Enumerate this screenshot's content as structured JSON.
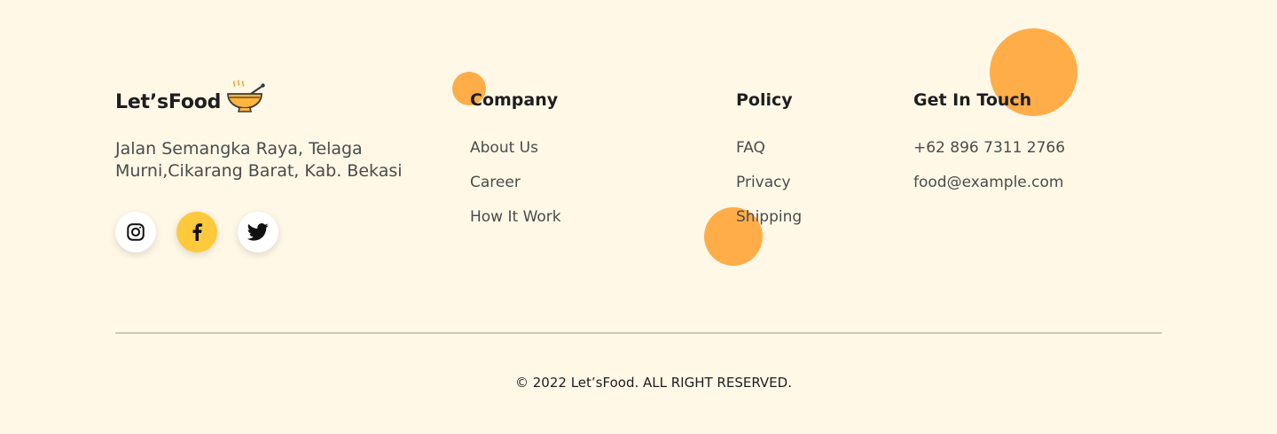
{
  "brand": {
    "name": "Let’sFood",
    "address": "Jalan Semangka Raya, Telaga Murni,Cikarang Barat, Kab. Bekasi",
    "socials": [
      {
        "icon": "instagram-icon"
      },
      {
        "icon": "facebook-icon",
        "active": true
      },
      {
        "icon": "twitter-icon"
      }
    ]
  },
  "company": {
    "title": "Company",
    "links": [
      "About Us",
      "Career",
      "How It Work"
    ]
  },
  "policy": {
    "title": "Policy",
    "links": [
      "FAQ",
      "Privacy",
      "Shipping"
    ]
  },
  "contact": {
    "title": "Get In Touch",
    "phone": "+62 896 7311 2766",
    "email": "food@example.com"
  },
  "copyright": "© 2022 Let’sFood. ALL RIGHT RESERVED.",
  "colors": {
    "background": "#fff8e7",
    "accent_orange": "#ffad49",
    "accent_yellow": "#ffc93c",
    "text": "#1e1e1e",
    "muted_text": "#4b4b4b"
  }
}
